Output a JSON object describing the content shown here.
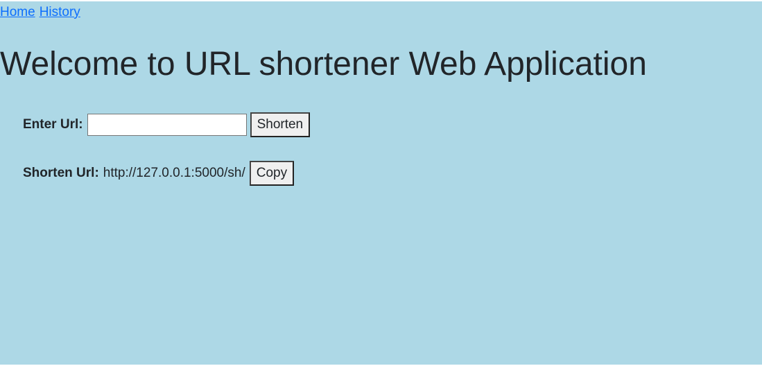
{
  "nav": {
    "home": "Home",
    "history": "History"
  },
  "heading": "Welcome to URL shortener Web Application",
  "form": {
    "enter_label": "Enter Url:",
    "url_value": "",
    "shorten_button": "Shorten"
  },
  "result": {
    "label": "Shorten Url:",
    "value": "http://127.0.0.1:5000/sh/",
    "copy_button": "Copy"
  },
  "colors": {
    "background": "#add8e6",
    "link": "#0d6efd",
    "text": "#212529"
  }
}
